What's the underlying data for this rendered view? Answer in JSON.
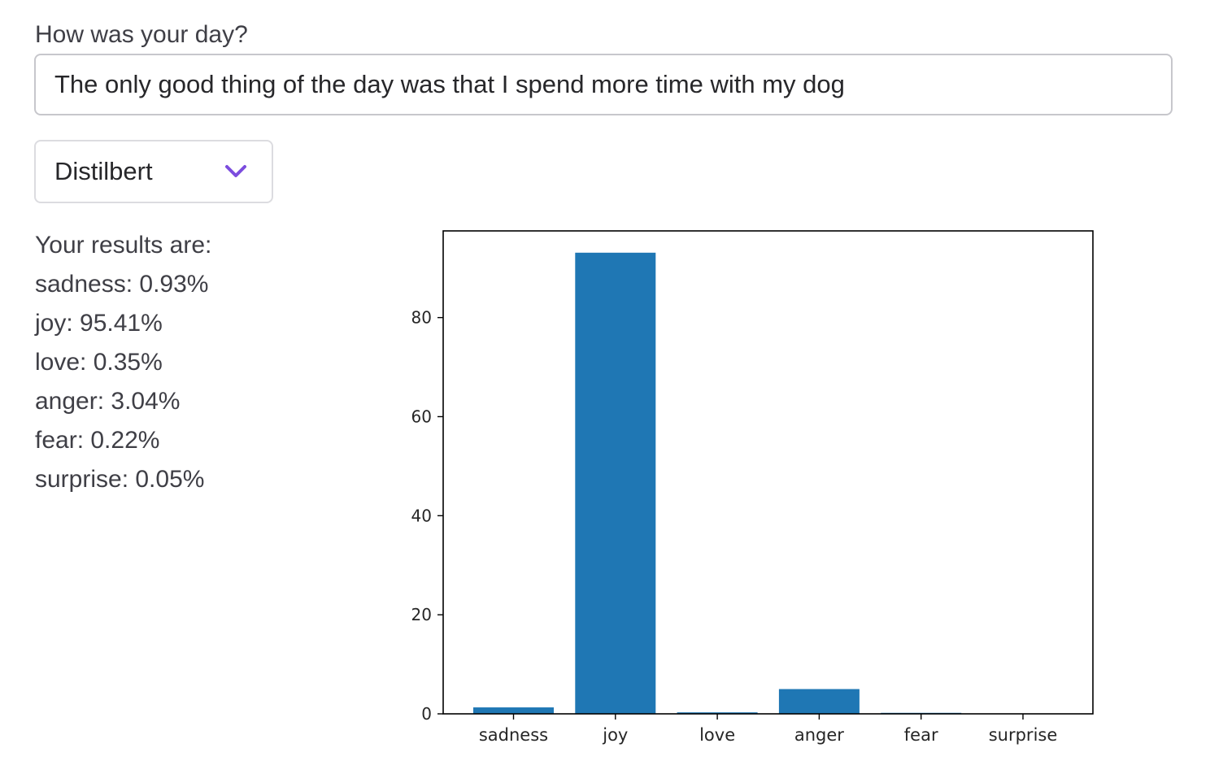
{
  "prompt": {
    "label": "How was your day?",
    "value": "The only good thing of the day was that I spend more time with my dog"
  },
  "model_select": {
    "value": "Distilbert",
    "icon": "chevron-down-icon",
    "accent_color": "#7c4dde"
  },
  "results": {
    "heading": "Your results are:",
    "lines": [
      "sadness: 0.93%",
      "joy: 95.41%",
      "love: 0.35%",
      "anger: 3.04%",
      "fear: 0.22%",
      "surprise: 0.05%"
    ]
  },
  "chart_data": {
    "type": "bar",
    "categories": [
      "sadness",
      "joy",
      "love",
      "anger",
      "fear",
      "surprise"
    ],
    "values": [
      1.3,
      93.1,
      0.3,
      5.0,
      0.2,
      0.05
    ],
    "ylim": [
      0,
      97.5
    ],
    "yticks": [
      0,
      20,
      40,
      60,
      80
    ],
    "title": "",
    "xlabel": "",
    "ylabel": "",
    "bar_color": "#1f77b4"
  }
}
